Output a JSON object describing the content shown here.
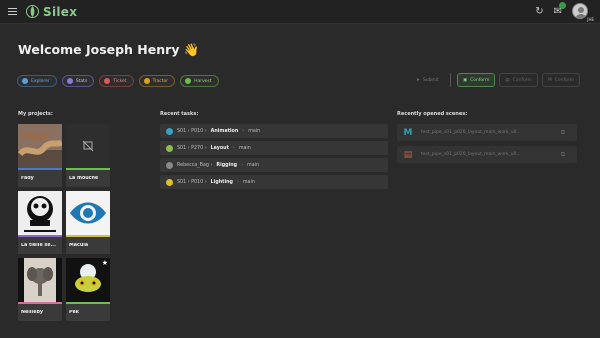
{
  "app": {
    "name": "Silex"
  },
  "topbar": {
    "icons": [
      "menu-icon",
      "refresh-icon",
      "notifications-icon",
      "avatar"
    ],
    "avatar_sub": "JHE"
  },
  "welcome": {
    "text": "Welcome Joseph Henry",
    "emoji": "👋"
  },
  "filters": [
    {
      "label": "Explorer",
      "color": "#5aa0d8",
      "text_color": "#6ab0e8",
      "border": "#3d5c7a"
    },
    {
      "label": "Stats",
      "color": "#8a7ae0",
      "text_color": "#c8c0f0",
      "border": "#5a4e9a"
    },
    {
      "label": "Ticket",
      "color": "#d85a5a",
      "text_color": "#e88888",
      "border": "#7a3d3d"
    },
    {
      "label": "Tractor",
      "color": "#e0a020",
      "text_color": "#e0b040",
      "border": "#7a5d1d"
    },
    {
      "label": "Harvest",
      "color": "#6ac04a",
      "text_color": "#9ad07a",
      "border": "#4a7a3a"
    }
  ],
  "actions": [
    {
      "label": "Submit",
      "state": "disabled-flat"
    },
    {
      "label": "Conform",
      "state": "primary"
    },
    {
      "label": "Conform",
      "state": "disabled"
    },
    {
      "label": "Conform",
      "state": "disabled"
    }
  ],
  "sections": {
    "projects": "My projects:",
    "tasks": "Recent tasks:",
    "scenes": "Recently opened scenes:"
  },
  "projects": [
    {
      "name": "Fady",
      "bar": "#4a7ac0",
      "thumb": "snake"
    },
    {
      "name": "La mouche",
      "bar": "#6ac04a",
      "thumb": "empty"
    },
    {
      "name": "La tielle se...",
      "bar": "#8a6ac0",
      "thumb": "skull"
    },
    {
      "name": "Macula",
      "bar": "#d0c040",
      "thumb": "eye"
    },
    {
      "name": "Nellieby",
      "bar": "#e06a9a",
      "thumb": "elephant"
    },
    {
      "name": "Pek",
      "bar": "#6ac04a",
      "thumb": "frog",
      "starred": true
    }
  ],
  "tasks": [
    {
      "prefix": "S01 › P010 ›",
      "name": "Animation",
      "suffix": "main",
      "color": "#3aa0c0"
    },
    {
      "prefix": "S01 › P270 ›",
      "name": "Layout",
      "suffix": "main",
      "color": "#8ac04a"
    },
    {
      "prefix": "Rebecca_Bag ›",
      "name": "Rigging",
      "suffix": "main",
      "color": "#888888"
    },
    {
      "prefix": "S01 › P010 ›",
      "name": "Lighting",
      "suffix": "main",
      "color": "#e0c030"
    }
  ],
  "scenes": [
    {
      "label": "test_pipe_s01_p020_layout_main_work_v0...",
      "icon_letter": "M",
      "icon_color": "#2aa0b0"
    },
    {
      "label": "test_pipe_s01_p020_layout_main_work_v0...",
      "icon_letter": "▤",
      "icon_color": "#c06040"
    }
  ]
}
